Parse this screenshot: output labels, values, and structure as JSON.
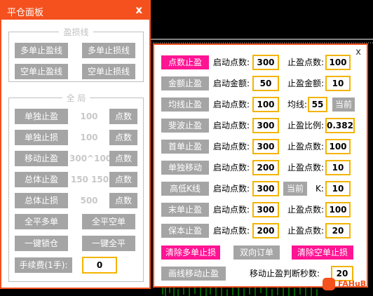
{
  "left_panel": {
    "title": "平仓面板",
    "close": "x",
    "stoploss_group": {
      "legend": "盈损线",
      "buttons": [
        "多单止盈线",
        "多单止损线",
        "空单止盈线",
        "空单止损线"
      ]
    },
    "global_group": {
      "legend": "全 局",
      "rows": [
        {
          "action": "单独止盈",
          "value": "100",
          "unit": "点数"
        },
        {
          "action": "单独止损",
          "value": "100",
          "unit": "点数"
        },
        {
          "action": "移动止盈",
          "value": "300^100",
          "unit": "点数"
        },
        {
          "action": "总体止盈",
          "value": "150 150",
          "unit": "点数"
        },
        {
          "action": "总体止损",
          "value": "500",
          "unit": "点数"
        }
      ],
      "close_all_long": "全平多单",
      "close_all_short": "全平空单",
      "one_click_lock": "一键锁仓",
      "one_click_close": "一键全平",
      "fee_label": "手续费(1手):",
      "fee_value": "0"
    }
  },
  "right_panel": {
    "close": "x",
    "rows": [
      {
        "btn": "点数止盈",
        "active": true,
        "l1": "启动点数:",
        "v1": "300",
        "l2": "止盈点数:",
        "v2": "100"
      },
      {
        "btn": "金额止盈",
        "active": false,
        "l1": "启动金额:",
        "v1": "50",
        "l2": "止盈金额:",
        "v2": "10"
      },
      {
        "btn": "均线止盈",
        "active": false,
        "l1": "启动点数:",
        "v1": "100",
        "l2": "均线:",
        "v2": "55",
        "extra": "当前"
      },
      {
        "btn": "斐波止盈",
        "active": false,
        "l1": "启动点数:",
        "v1": "300",
        "l2": "止盈比例:",
        "v2": "0.382"
      },
      {
        "btn": "首单止盈",
        "active": false,
        "l1": "启动点数:",
        "v1": "300",
        "l2": "止盈点数:",
        "v2": "100"
      },
      {
        "btn": "单独移动",
        "active": false,
        "l1": "启动点数:",
        "v1": "200",
        "l2": "止盈点数:",
        "v2": "10"
      },
      {
        "btn": "高低K线",
        "active": false,
        "l1": "启动点数:",
        "v1": "300",
        "extra": "当前",
        "l2": "K:",
        "v2": "10"
      },
      {
        "btn": "末单止盈",
        "active": false,
        "l1": "启动点数:",
        "v1": "300",
        "l2": "止盈点数:",
        "v2": "100"
      },
      {
        "btn": "保本止盈",
        "active": false,
        "l1": "启动点数:",
        "v1": "200",
        "l2": "止盈点数:",
        "v2": "20"
      }
    ],
    "clear_long_sl": "清除多单止损",
    "bidirectional_order": "双向订单",
    "clear_short_sl": "清除空单止损",
    "draw_trailing": "画线移动止盈",
    "move_tp_label": "移动止盈判断秒数:",
    "move_tp_value": "20"
  },
  "watermark": {
    "text": "FAHuB"
  },
  "colors": {
    "accent": "#f4511e",
    "active": "#ff1493",
    "inactive": "#a5a5a5",
    "field_border": "#f4b400"
  }
}
